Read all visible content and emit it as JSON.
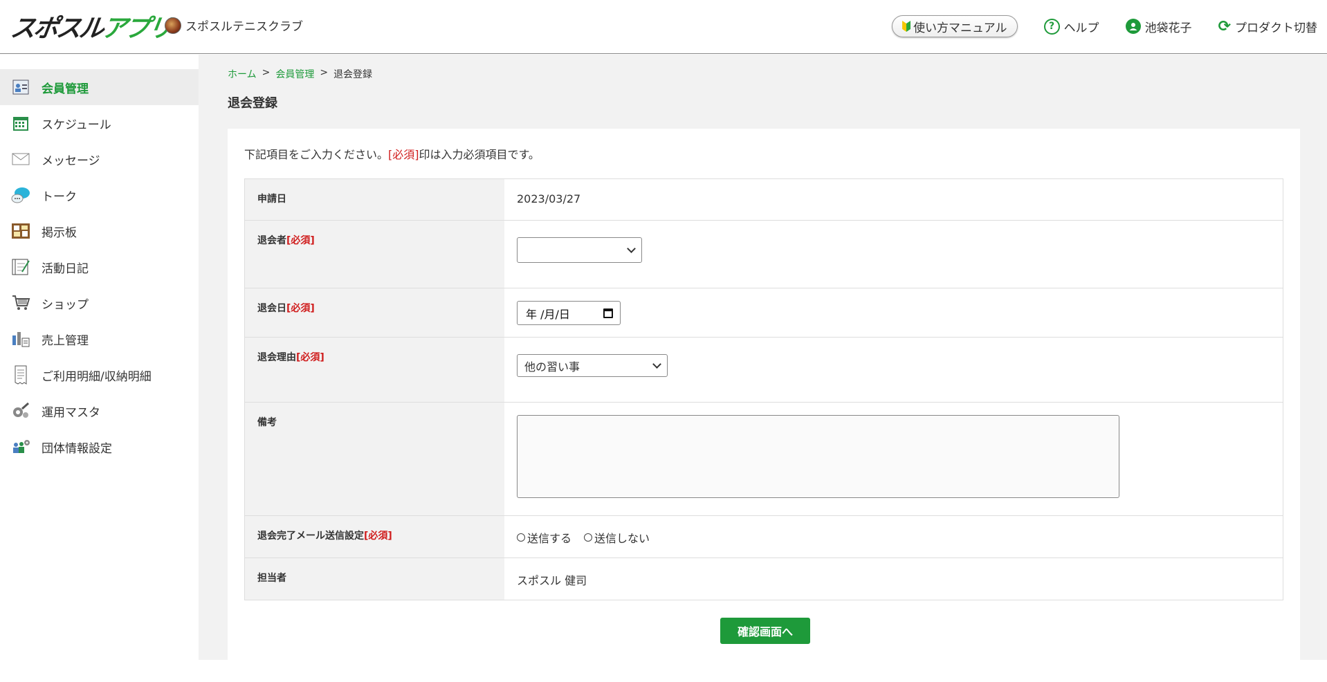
{
  "header": {
    "logo_dark": "スポスル",
    "logo_green": "アプリ",
    "club_name": "スポスルテニスクラブ",
    "manual_label": "使い方マニュアル",
    "help_label": "ヘルプ",
    "user_name": "池袋花子",
    "product_switch_label": "プロダクト切替"
  },
  "sidebar": {
    "items": [
      {
        "label": "会員管理",
        "icon": "member-management-icon",
        "active": true
      },
      {
        "label": "スケジュール",
        "icon": "calendar-icon"
      },
      {
        "label": "メッセージ",
        "icon": "envelope-icon"
      },
      {
        "label": "トーク",
        "icon": "chat-bubble-icon"
      },
      {
        "label": "掲示板",
        "icon": "bulletin-board-icon"
      },
      {
        "label": "活動日記",
        "icon": "diary-icon"
      },
      {
        "label": "ショップ",
        "icon": "cart-icon"
      },
      {
        "label": "売上管理",
        "icon": "sales-icon"
      },
      {
        "label": "ご利用明細/収納明細",
        "icon": "invoice-icon"
      },
      {
        "label": "運用マスタ",
        "icon": "gear-wrench-icon"
      },
      {
        "label": "団体情報設定",
        "icon": "group-settings-icon"
      }
    ]
  },
  "breadcrumb": {
    "home": "ホーム",
    "sep": ">",
    "member": "会員管理",
    "current": "退会登録"
  },
  "page_title": "退会登録",
  "instruction": {
    "before": "下記項目をご入力ください。",
    "required_tag": "[必須]",
    "after": "印は入力必須項目です。"
  },
  "form": {
    "required_tag": "[必須]",
    "application_date_label": "申請日",
    "application_date_value": "2023/03/27",
    "withdrawer_label": "退会者",
    "withdrawer_value": "",
    "withdraw_date_label": "退会日",
    "withdraw_date_placeholder": "年 /月/日",
    "reason_label": "退会理由",
    "reason_value": "他の習い事",
    "note_label": "備考",
    "note_value": "",
    "mail_label": "退会完了メール送信設定",
    "mail_option_send": "送信する",
    "mail_option_nosend": "送信しない",
    "staff_label": "担当者",
    "staff_value": "スポスル 健司"
  },
  "submit_label": "確認画面へ",
  "colors": {
    "accent": "#1e9a3a",
    "required": "#d01d1d",
    "main_bg": "#f2f2f2"
  }
}
